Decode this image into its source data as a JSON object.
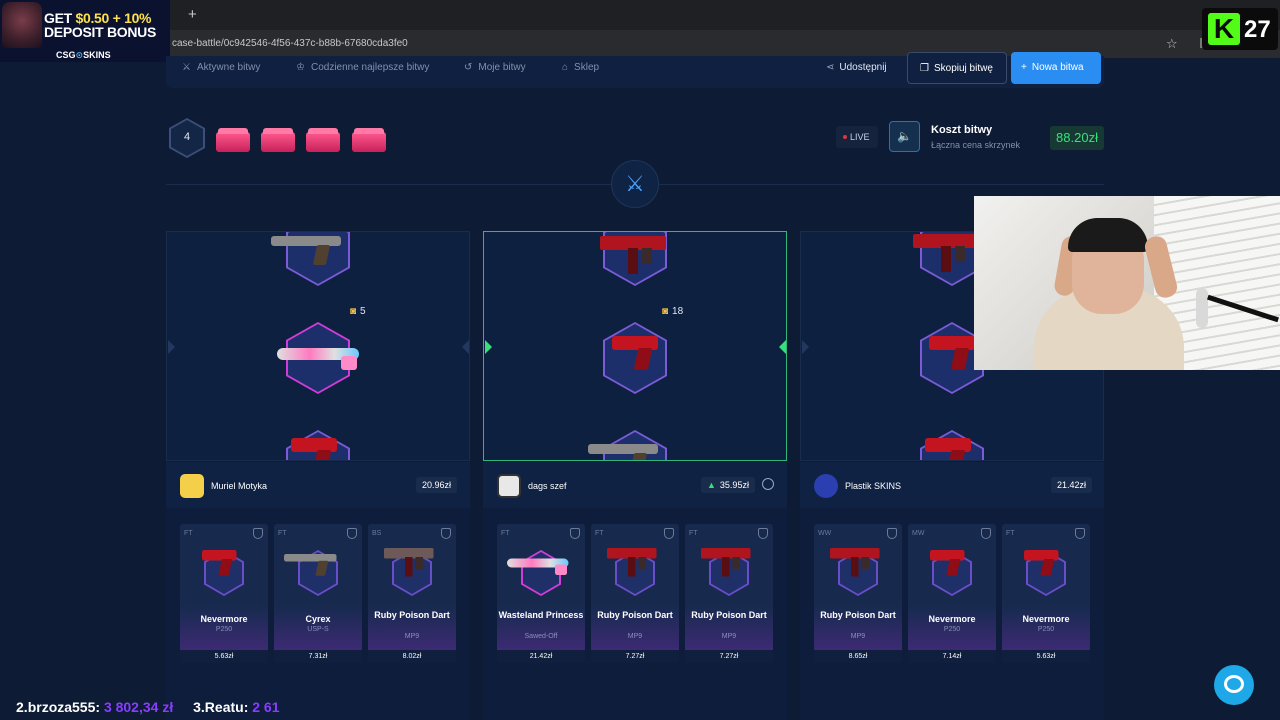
{
  "browser": {
    "new_tab": "+",
    "url": "case-battle/0c942546-4f56-437c-b88b-67680cda3fe0"
  },
  "promo": {
    "line1_a": "GET ",
    "line1_b": "$0.50",
    "line1_c": " + 10%",
    "line2": "DEPOSIT BONUS",
    "brand_a": "CSG",
    "brand_b": "⊙",
    "brand_c": "SKINS"
  },
  "kick": {
    "logo": "K",
    "number": "27"
  },
  "nav": {
    "items": [
      {
        "label": "Aktywne bitwy",
        "icon": "swords-icon"
      },
      {
        "label": "Codzienne najlepsze bitwy",
        "icon": "trophy-icon"
      },
      {
        "label": "Moje bitwy",
        "icon": "history-icon"
      },
      {
        "label": "Sklep",
        "icon": "shop-icon"
      }
    ],
    "share": "Udostępnij",
    "copy": "Skopiuj bitwę",
    "new": "Nowa bitwa"
  },
  "battle": {
    "rounds": "4",
    "live": "LIVE",
    "cost_title": "Koszt bitwy",
    "cost_sub": "Łączna cena skrzynek",
    "cost_value": "88.20zł"
  },
  "spinners": [
    {
      "count": "5"
    },
    {
      "count": "18"
    },
    {
      "count": ""
    }
  ],
  "players": [
    {
      "name": "Muriel Motyka",
      "value": "20.96zł",
      "items": [
        {
          "wear": "FT",
          "name": "Nevermore",
          "type": "P250",
          "price": "5.63zł",
          "gun": "pistol-red"
        },
        {
          "wear": "FT",
          "name": "Cyrex",
          "type": "USP-S",
          "price": "7.31zł",
          "gun": "pistol-usp"
        },
        {
          "wear": "BS",
          "name": "Ruby Poison Dart",
          "type": "MP9",
          "price": "8.02zł",
          "gun": "smg-red"
        }
      ]
    },
    {
      "name": "dags szef",
      "value": "35.95zł",
      "items": [
        {
          "wear": "FT",
          "name": "Wasteland Princess",
          "type": "Sawed-Off",
          "price": "21.42zł",
          "gun": "shotgun"
        },
        {
          "wear": "FT",
          "name": "Ruby Poison Dart",
          "type": "MP9",
          "price": "7.27zł",
          "gun": "smg-red"
        },
        {
          "wear": "FT",
          "name": "Ruby Poison Dart",
          "type": "MP9",
          "price": "7.27zł",
          "gun": "smg-red"
        }
      ]
    },
    {
      "name": "Plastik SKINS",
      "value": "21.42zł",
      "items": [
        {
          "wear": "WW",
          "name": "Ruby Poison Dart",
          "type": "MP9",
          "price": "8.65zł",
          "gun": "smg-red"
        },
        {
          "wear": "MW",
          "name": "Nevermore",
          "type": "P250",
          "price": "7.14zł",
          "gun": "pistol-red"
        },
        {
          "wear": "FT",
          "name": "Nevermore",
          "type": "P250",
          "price": "5.63zł",
          "gun": "pistol-red"
        }
      ]
    }
  ],
  "leaderboard": [
    {
      "rank": "2.",
      "name": "brzoza555:",
      "amount": "3 802,34 zł"
    },
    {
      "rank": "3.",
      "name": "Reatu:",
      "amount": "2 61"
    }
  ],
  "colors": {
    "background": "#0d1b35",
    "accent_blue": "#2a8df2",
    "win_green": "#37e07a",
    "case_pink": "#ff5a90"
  }
}
